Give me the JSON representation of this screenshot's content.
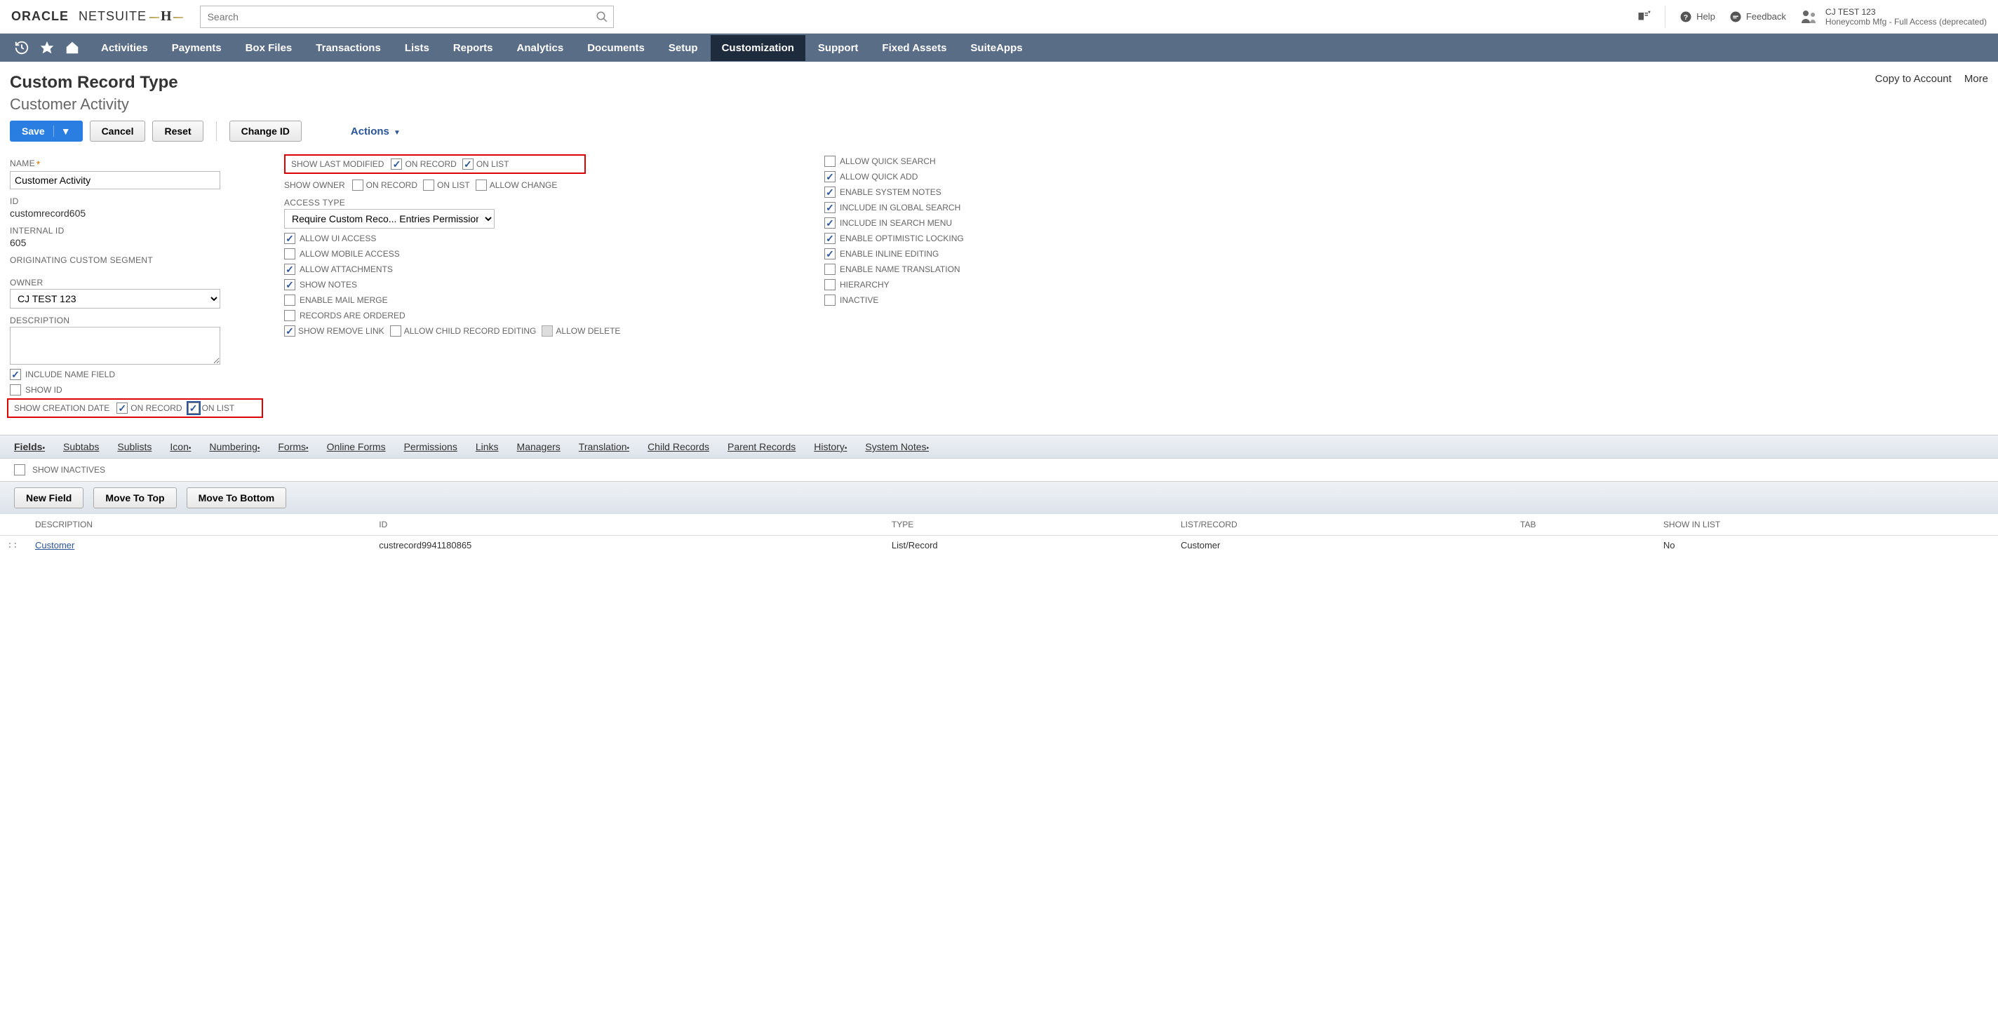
{
  "header": {
    "logo_primary": "ORACLE",
    "logo_secondary": "NETSUITE",
    "secondary_brand": "H",
    "search_placeholder": "Search",
    "help_label": "Help",
    "feedback_label": "Feedback",
    "user_name": "CJ TEST 123",
    "user_role": "Honeycomb Mfg - Full Access (deprecated)"
  },
  "nav": {
    "items": [
      "Activities",
      "Payments",
      "Box Files",
      "Transactions",
      "Lists",
      "Reports",
      "Analytics",
      "Documents",
      "Setup",
      "Customization",
      "Support",
      "Fixed Assets",
      "SuiteApps"
    ],
    "active_index": 9
  },
  "page": {
    "title": "Custom Record Type",
    "subtitle": "Customer Activity",
    "right_links": [
      "Copy to Account",
      "More"
    ]
  },
  "toolbar": {
    "save_label": "Save",
    "cancel_label": "Cancel",
    "reset_label": "Reset",
    "change_id_label": "Change ID",
    "actions_label": "Actions"
  },
  "col1": {
    "name_label": "NAME",
    "name_value": "Customer Activity",
    "id_label": "ID",
    "id_value": "customrecord605",
    "internal_id_label": "INTERNAL ID",
    "internal_id_value": "605",
    "orig_segment_label": "ORIGINATING CUSTOM SEGMENT",
    "owner_label": "OWNER",
    "owner_value": "CJ TEST 123",
    "description_label": "DESCRIPTION",
    "include_name_label": "INCLUDE NAME FIELD",
    "show_id_label": "SHOW ID",
    "show_creation_date_label": "SHOW CREATION DATE",
    "on_record_label": "ON RECORD",
    "on_list_label": "ON LIST"
  },
  "col2": {
    "show_last_modified_label": "SHOW LAST MODIFIED",
    "on_record_label": "ON RECORD",
    "on_list_label": "ON LIST",
    "show_owner_label": "SHOW OWNER",
    "allow_change_label": "ALLOW CHANGE",
    "access_type_label": "ACCESS TYPE",
    "access_type_value": "Require Custom Reco... Entries Permission",
    "allow_ui_access_label": "ALLOW UI ACCESS",
    "allow_mobile_access_label": "ALLOW MOBILE ACCESS",
    "allow_attachments_label": "ALLOW ATTACHMENTS",
    "show_notes_label": "SHOW NOTES",
    "enable_mail_merge_label": "ENABLE MAIL MERGE",
    "records_are_ordered_label": "RECORDS ARE ORDERED",
    "show_remove_link_label": "SHOW REMOVE LINK",
    "allow_child_record_editing_label": "ALLOW CHILD RECORD EDITING",
    "allow_delete_label": "ALLOW DELETE"
  },
  "col3": {
    "allow_quick_search_label": "ALLOW QUICK SEARCH",
    "allow_quick_add_label": "ALLOW QUICK ADD",
    "enable_system_notes_label": "ENABLE SYSTEM NOTES",
    "include_in_global_search_label": "INCLUDE IN GLOBAL SEARCH",
    "include_in_search_menu_label": "INCLUDE IN SEARCH MENU",
    "enable_optimistic_locking_label": "ENABLE OPTIMISTIC LOCKING",
    "enable_inline_editing_label": "ENABLE INLINE EDITING",
    "enable_name_translation_label": "ENABLE NAME TRANSLATION",
    "hierarchy_label": "HIERARCHY",
    "inactive_label": "INACTIVE"
  },
  "subtabs": {
    "items": [
      {
        "label": "Fields",
        "dot": true
      },
      {
        "label": "Subtabs",
        "dot": false
      },
      {
        "label": "Sublists",
        "dot": false
      },
      {
        "label": "Icon",
        "dot": true
      },
      {
        "label": "Numbering",
        "dot": true
      },
      {
        "label": "Forms",
        "dot": true
      },
      {
        "label": "Online Forms",
        "dot": false
      },
      {
        "label": "Permissions",
        "dot": false
      },
      {
        "label": "Links",
        "dot": false
      },
      {
        "label": "Managers",
        "dot": false
      },
      {
        "label": "Translation",
        "dot": true
      },
      {
        "label": "Child Records",
        "dot": false
      },
      {
        "label": "Parent Records",
        "dot": false
      },
      {
        "label": "History",
        "dot": true
      },
      {
        "label": "System Notes",
        "dot": true
      }
    ],
    "active_index": 0
  },
  "sub_toolbar": {
    "show_inactives_label": "SHOW INACTIVES"
  },
  "table_toolbar": {
    "new_field_label": "New Field",
    "move_to_top_label": "Move To Top",
    "move_to_bottom_label": "Move To Bottom"
  },
  "table": {
    "headers": [
      "DESCRIPTION",
      "ID",
      "TYPE",
      "LIST/RECORD",
      "TAB",
      "SHOW IN LIST"
    ],
    "rows": [
      {
        "description": "Customer",
        "id": "custrecord9941180865",
        "type": "List/Record",
        "list_record": "Customer",
        "tab": "",
        "show_in_list": "No"
      }
    ]
  }
}
